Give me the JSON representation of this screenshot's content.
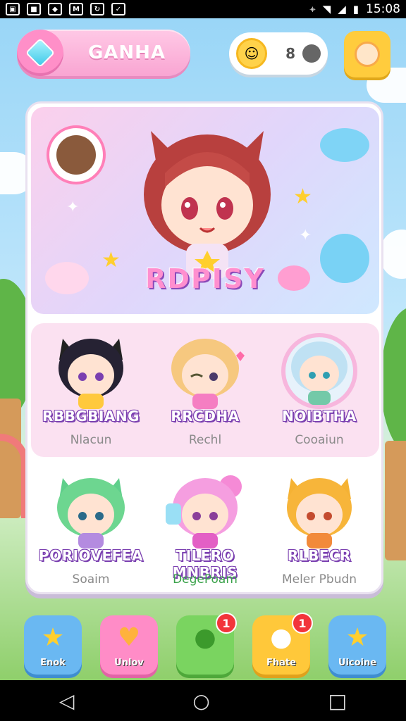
{
  "status_bar": {
    "left_icons": [
      "sim-icon",
      "notification-icon",
      "app-icon",
      "gmail-icon",
      "sync-icon",
      "drive-icon"
    ],
    "time": "15:08"
  },
  "header": {
    "title": "GANHA",
    "coin_count": "8"
  },
  "hero": {
    "title": "RDPISY"
  },
  "characters_row1": [
    {
      "name": "RBBGBIANG",
      "subtitle": "Nlacun",
      "color": "#7a3fb0"
    },
    {
      "name": "RRCDHA",
      "subtitle": "Rechl",
      "color": "#7a3fb0"
    },
    {
      "name": "NOIBTHA",
      "subtitle": "Cooaiun",
      "color": "#7a3fb0"
    }
  ],
  "characters_row2": [
    {
      "name": "PORIOVEFEA",
      "subtitle": "Soaim"
    },
    {
      "name": "TILERO MNBRIS",
      "subtitle": "DegePoam"
    },
    {
      "name": "RLBECR",
      "subtitle": "Meler Pbudn"
    }
  ],
  "bottom_nav": [
    {
      "label": "Enok",
      "icon": "star-icon",
      "color": "#6ab8f2",
      "badge": ""
    },
    {
      "label": "Unlov",
      "icon": "heart-icon",
      "color": "#ff8cc7",
      "badge": ""
    },
    {
      "label": "",
      "icon": "leaf-icon",
      "color": "#7ad460",
      "badge": "1"
    },
    {
      "label": "Fhate",
      "icon": "chat-icon",
      "color": "#ffc83a",
      "badge": "1"
    },
    {
      "label": "Uicoine",
      "icon": "star-icon",
      "color": "#6ab8f2",
      "badge": ""
    }
  ],
  "colors": {
    "accent_pink": "#ff8fc8",
    "accent_yellow": "#ffcc3d",
    "outline_purple": "#7a3fb0"
  }
}
